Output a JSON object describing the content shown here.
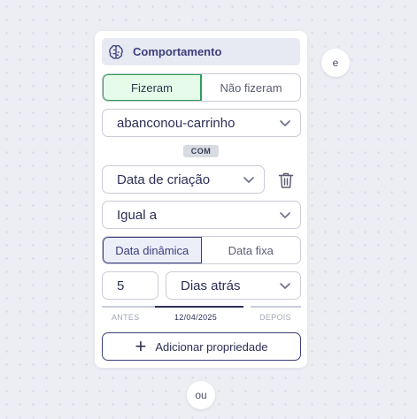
{
  "behavior": {
    "header_title": "Comportamento",
    "header_icon": "brain-icon",
    "toggle": {
      "did": "Fizeram",
      "did_not": "Não fizeram",
      "selected": "Fizeram"
    },
    "event_value": "abanconou-carrinho",
    "with_badge": "COM",
    "property_value": "Data de criação",
    "operator_value": "Igual a",
    "date_mode": {
      "dynamic": "Data dinâmica",
      "fixed": "Data fixa",
      "selected": "Data dinâmica"
    },
    "amount_value": "5",
    "unit_value": "Dias atrás",
    "timeline": {
      "before": "ANTES",
      "date": "12/04/2025",
      "after": "DEPOIS"
    },
    "add_property_label": "Adicionar propriedade"
  },
  "connectors": {
    "and_label": "e",
    "or_label": "ou"
  },
  "colors": {
    "accent": "#3b3f7a",
    "green": "#2e9e56",
    "green_bg": "#e6fbe9",
    "canvas": "#eceef3"
  }
}
